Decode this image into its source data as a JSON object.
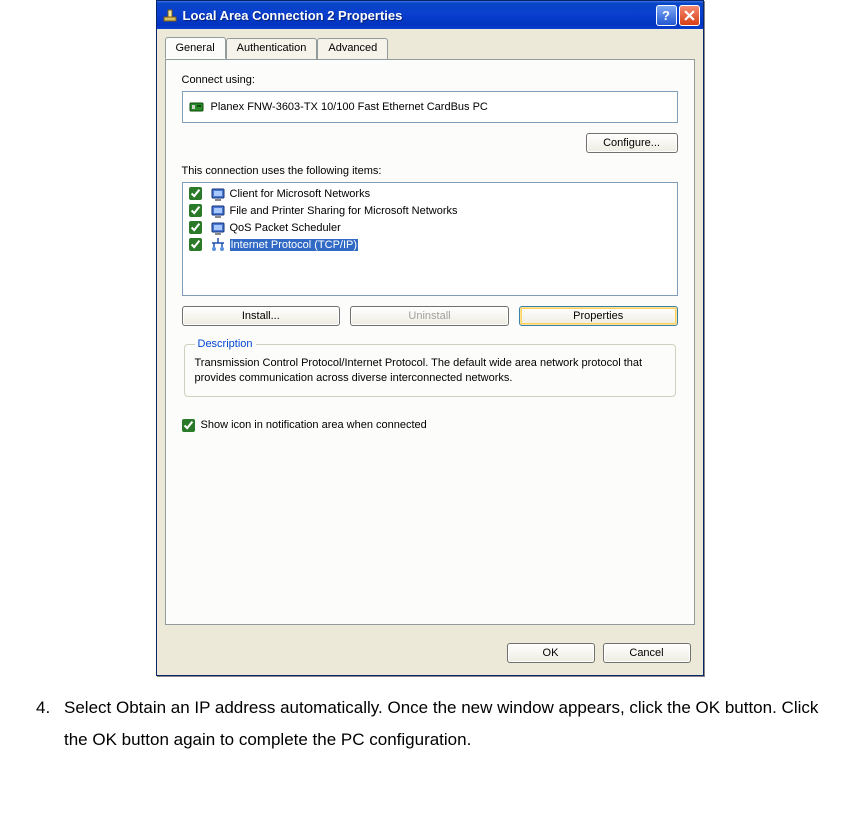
{
  "window": {
    "title": "Local Area Connection 2 Properties"
  },
  "tabs": {
    "general": "General",
    "authentication": "Authentication",
    "advanced": "Advanced"
  },
  "connectUsing": {
    "label": "Connect using:",
    "adapter": "Planex FNW-3603-TX 10/100 Fast Ethernet CardBus PC"
  },
  "configureBtn": "Configure...",
  "itemsLabel": "This connection uses the following items:",
  "items": [
    {
      "label": "Client for Microsoft Networks",
      "checked": true,
      "selected": false
    },
    {
      "label": "File and Printer Sharing for Microsoft Networks",
      "checked": true,
      "selected": false
    },
    {
      "label": "QoS Packet Scheduler",
      "checked": true,
      "selected": false
    },
    {
      "label": "Internet Protocol (TCP/IP)",
      "checked": true,
      "selected": true
    }
  ],
  "buttons": {
    "install": "Install...",
    "uninstall": "Uninstall",
    "properties": "Properties",
    "ok": "OK",
    "cancel": "Cancel"
  },
  "description": {
    "legend": "Description",
    "text": "Transmission Control Protocol/Internet Protocol. The default wide area network protocol that provides communication across diverse interconnected networks."
  },
  "showIconLabel": "Show icon in notification area when connected",
  "instruction": {
    "number": "4.",
    "text": "Select Obtain an IP address automatically. Once the new window appears, click the OK button. Click the OK button again to complete the PC configuration."
  }
}
